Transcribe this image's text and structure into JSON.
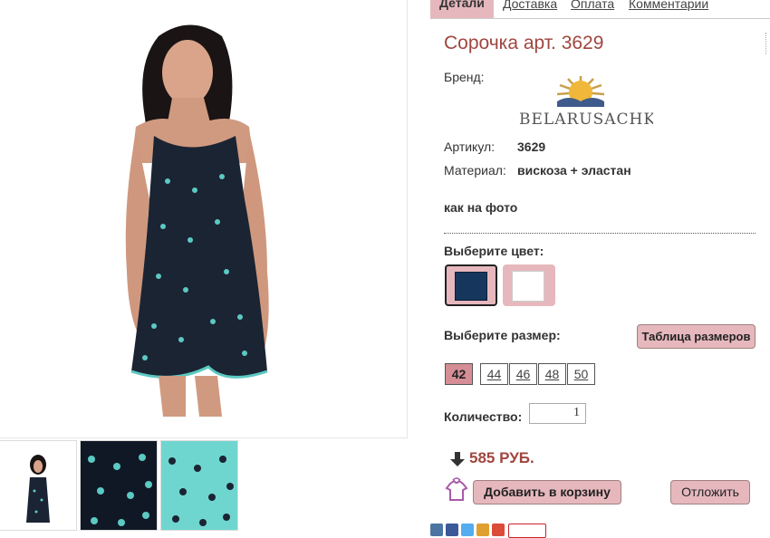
{
  "tabs": [
    {
      "label": "Детали"
    },
    {
      "label": "Доставка"
    },
    {
      "label": "Оплата"
    },
    {
      "label": "Комментарии"
    }
  ],
  "product": {
    "title": "Сорочка арт. 3629",
    "brand_label": "Бренд:",
    "brand_logo_text": "BELARUSACHKA",
    "article_label": "Артикул:",
    "article_value": "3629",
    "material_label": "Материал:",
    "material_value": "вискоза + эластан",
    "note": "как на фото"
  },
  "color": {
    "label": "Выберите цвет:",
    "options": [
      {
        "name": "navy",
        "hex": "#17365d",
        "selected": true
      },
      {
        "name": "white",
        "hex": "#ffffff",
        "selected": false
      }
    ]
  },
  "size": {
    "label": "Выберите размер:",
    "table_button": "Таблица размеров",
    "options": [
      "42",
      "44",
      "46",
      "48",
      "50"
    ],
    "selected": "42"
  },
  "quantity": {
    "label": "Количество:",
    "value": "1"
  },
  "price": {
    "text": "585 РУБ."
  },
  "actions": {
    "add_to_cart": "Добавить в корзину",
    "defer": "Отложить"
  },
  "colors": {
    "accent": "#a0463f",
    "button_bg": "#e6b8bd",
    "selected_size_bg": "#d58e95"
  }
}
